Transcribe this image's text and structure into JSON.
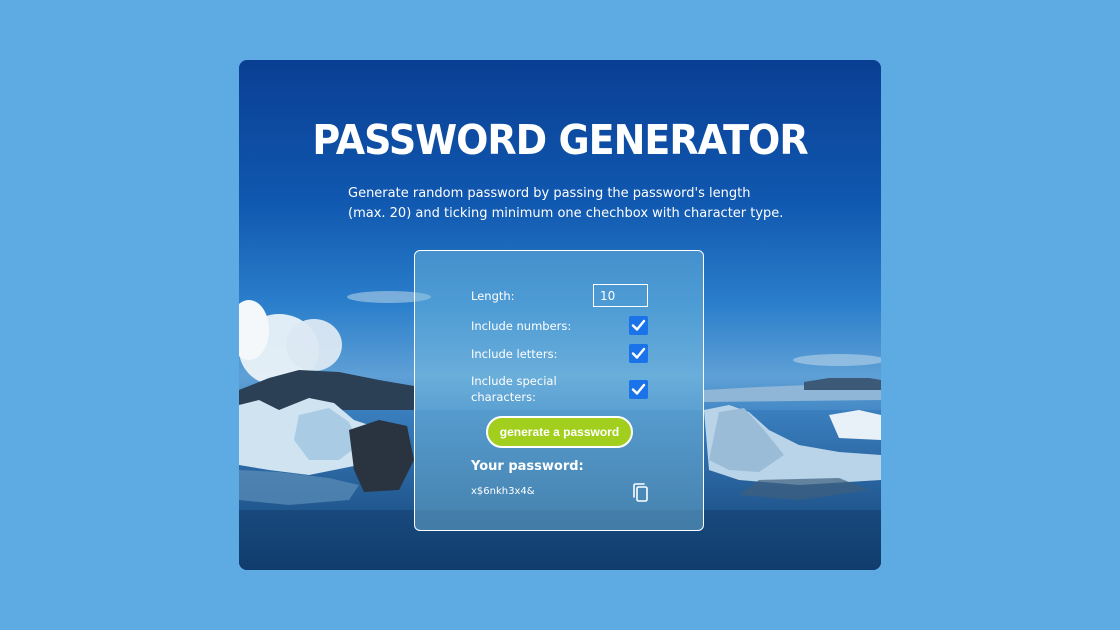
{
  "app": {
    "title": "PASSWORD GENERATOR",
    "description": "Generate random password by passing the password's length (max. 20) and ticking minimum one chechbox with character type."
  },
  "form": {
    "length_label": "Length:",
    "length_value": "10",
    "include_numbers_label": "Include numbers:",
    "include_numbers_checked": true,
    "include_letters_label": "Include letters:",
    "include_letters_checked": true,
    "include_special_label": "Include special characters:",
    "include_special_checked": true,
    "generate_button_label": "generate a password"
  },
  "result": {
    "heading": "Your password:",
    "password": "x$6nkh3x4&",
    "copy_icon": "copy-icon"
  },
  "colors": {
    "page_background": "#5eaae3",
    "button": "#a2cf1e",
    "checkbox": "#1a73e8"
  }
}
